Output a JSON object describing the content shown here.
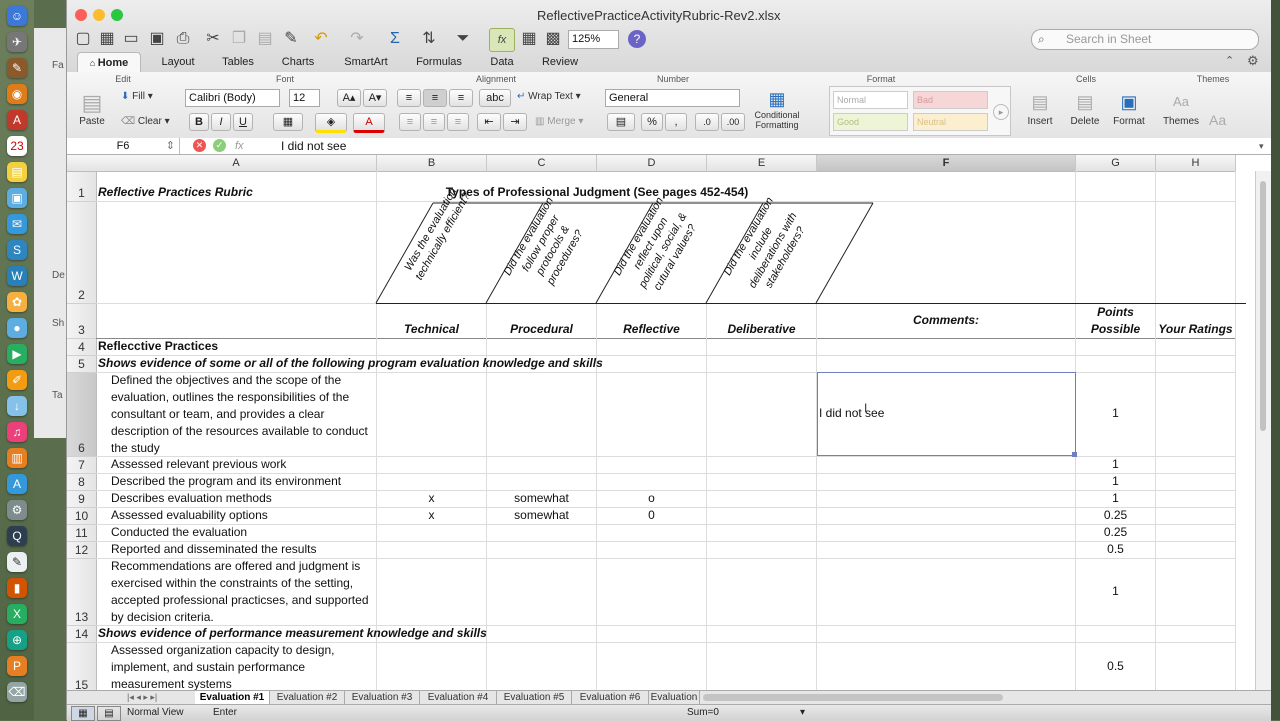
{
  "window": {
    "title": "ReflectivePracticeActivityRubric-Rev2.xlsx"
  },
  "toolbar": {
    "zoom": "125%",
    "search_placeholder": "Search in Sheet"
  },
  "ribbon_tabs": [
    "Home",
    "Layout",
    "Tables",
    "Charts",
    "SmartArt",
    "Formulas",
    "Data",
    "Review"
  ],
  "ribbon": {
    "groups": {
      "edit": "Edit",
      "font": "Font",
      "alignment": "Alignment",
      "number": "Number",
      "format": "Format",
      "cells": "Cells",
      "themes": "Themes"
    },
    "paste": "Paste",
    "fill": "Fill",
    "clear": "Clear",
    "font_name": "Calibri (Body)",
    "font_size": "12",
    "wrap_text": "Wrap Text",
    "merge": "Merge",
    "abc": "abc",
    "number_format": "General",
    "percent": "%",
    "comma": ",",
    "conditional_formatting_1": "Conditional",
    "conditional_formatting_2": "Formatting",
    "styles": {
      "normal": "Normal",
      "bad": "Bad",
      "good": "Good",
      "neutral": "Neutral"
    },
    "insert": "Insert",
    "delete": "Delete",
    "format_btn": "Format",
    "themes_btn": "Themes",
    "aa": "Aa"
  },
  "formula_bar": {
    "cell_ref": "F6",
    "fx": "fx",
    "content": "I did not see"
  },
  "columns": [
    "A",
    "B",
    "C",
    "D",
    "E",
    "F",
    "G",
    "H"
  ],
  "row_numbers": [
    "1",
    "2",
    "3",
    "4",
    "5",
    "6",
    "7",
    "8",
    "9",
    "10",
    "11",
    "12",
    "13",
    "14",
    "15"
  ],
  "sheet": {
    "a1": "Reflective Practices Rubric",
    "b1": "Types of Professional Judgment (See pages 452-454)",
    "questions": [
      "Was the evaluation technically efficient?",
      "Did the evaluation follow proper protocols & procedures?",
      "Did the evaluation reflect upon political, social, & cutural values?",
      "Did the evaluation include deliberations with stakeholders?"
    ],
    "h3": {
      "technical": "Technical",
      "procedural": "Procedural",
      "reflective": "Reflective",
      "deliberative": "Deliberative",
      "comments": "Comments:",
      "points_1": "Points",
      "points_2": "Possible",
      "ratings": "Your Ratings"
    },
    "a4": "Reflecctive Practices",
    "a5": "Shows evidence of some or all of the following program evaluation knowledge and skills",
    "a6": "Defined the objectives and the scope of the evaluation, outlines the responsibilities of the consultant or team, and provides a clear description of the resources available to conduct the study",
    "f6": "I did not see",
    "g6": "1",
    "a7": "Assessed relevant previous work",
    "g7": "1",
    "a8": "Described the program and its environment",
    "g8": "1",
    "a9": "Describes evaluation methods",
    "b9": "x",
    "c9": "somewhat",
    "d9": "o",
    "g9": "1",
    "a10": "Assessed evaluability options",
    "b10": "x",
    "c10": "somewhat",
    "d10": "0",
    "g10": "0.25",
    "a11": "Conducted the evaluation",
    "g11": "0.25",
    "a12": "Reported and disseminated the results",
    "g12": "0.5",
    "a13": "Recommendations are offered and judgment is exercised within the constraints of the setting, accepted professional practicses, and supported by decision criteria.",
    "g13": "1",
    "a14": "Shows evidence of performance measurement knowledge and skills",
    "a15": "Assessed organization capacity to design, implement, and sustain performance measurement systems",
    "g15": "0.5"
  },
  "sheet_tabs": [
    "Evaluation #1",
    "Evaluation #2",
    "Evaluation #3",
    "Evaluation #4",
    "Evaluation #5",
    "Evaluation #6",
    "Evaluation"
  ],
  "status": {
    "view": "Normal View",
    "mode": "Enter",
    "sum": "Sum=0"
  },
  "desktop": {
    "left_labels": [
      "Fa",
      "De",
      "Sh",
      "Ta"
    ]
  }
}
